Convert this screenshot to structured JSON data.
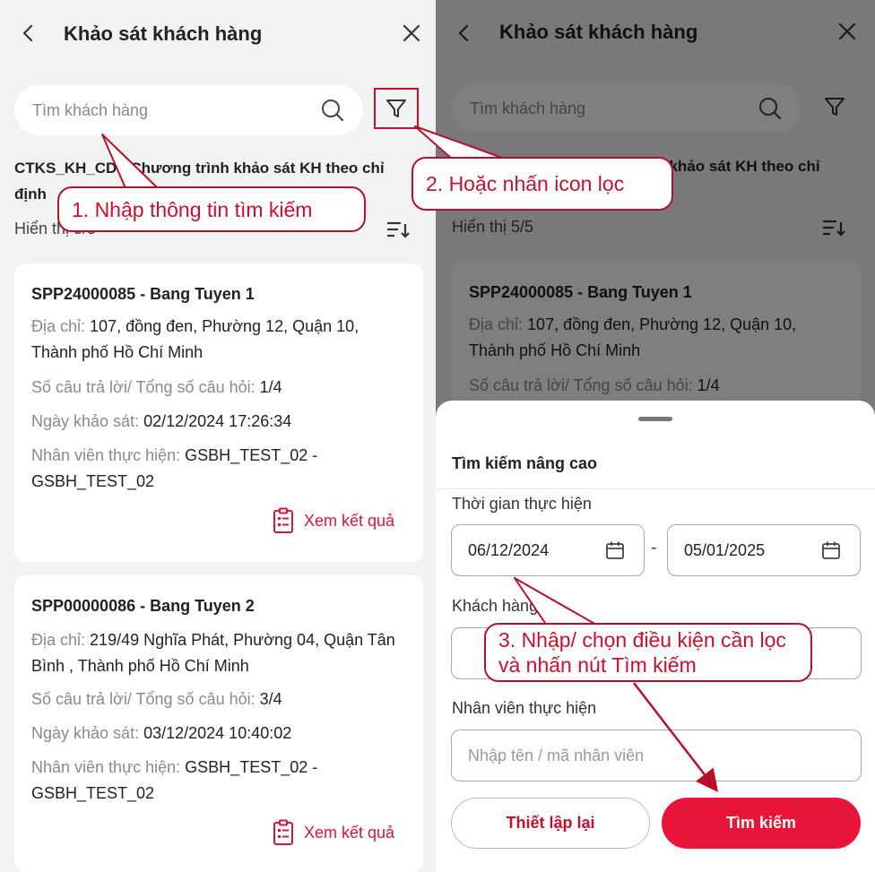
{
  "header": {
    "title": "Khảo sát khách hàng"
  },
  "search": {
    "placeholder": "Tìm khách hàng"
  },
  "program": {
    "text": "CTKS_KH_CD - Chương trình khảo sát KH theo chỉ định"
  },
  "list": {
    "count_left": "Hiển thị 5/5",
    "count_right": "Hiển thị 5/5",
    "cards": [
      {
        "title": "SPP24000085 - Bang Tuyen 1",
        "address_label": "Địa chỉ:",
        "address": "107, đồng đen, Phường 12, Quận 10, Thành phố Hồ Chí Minh",
        "answers_label": "Số câu trả lời/ Tổng số câu hỏi:",
        "answers": "1/4",
        "date_label": "Ngày khảo sát:",
        "date": "02/12/2024 17:26:34",
        "staff_label": "Nhân viên thực hiện:",
        "staff": "GSBH_TEST_02 - GSBH_TEST_02",
        "result_label": "Xem kết quả"
      },
      {
        "title": "SPP00000086 - Bang Tuyen 2",
        "address_label": "Địa chỉ:",
        "address": "219/49 Nghĩa Phát, Phường 04, Quận Tân Bình , Thành phố Hồ Chí Minh",
        "answers_label": "Số câu trả lời/ Tổng số câu hỏi:",
        "answers": "3/4",
        "date_label": "Ngày khảo sát:",
        "date": "03/12/2024 10:40:02",
        "staff_label": "Nhân viên thực hiện:",
        "staff": "GSBH_TEST_02 - GSBH_TEST_02",
        "result_label": "Xem kết quả"
      }
    ]
  },
  "sheet": {
    "title": "Tìm kiếm nâng cao",
    "time_label": "Thời gian thực hiện",
    "date_from": "06/12/2024",
    "date_to": "05/01/2025",
    "customer_label": "Khách hàng",
    "staff_label": "Nhân viên thực hiện",
    "staff_placeholder": "Nhập tên / mã nhân viên",
    "reset_label": "Thiết lập lại",
    "search_label": "Tìm kiếm"
  },
  "callouts": {
    "step1": "1. Nhập thông tin tìm kiếm",
    "step2": "2. Hoặc nhấn icon lọc",
    "step3": "3. Nhập/ chọn điều kiện cần lọc và nhấn nút Tìm kiếm"
  },
  "colors": {
    "accent": "#e8143a",
    "annotation": "#b8102a",
    "background": "#f2f2f2"
  },
  "icons": [
    "back-arrow-icon",
    "close-icon",
    "search-icon",
    "filter-icon",
    "sort-icon",
    "clipboard-icon",
    "calendar-icon"
  ]
}
